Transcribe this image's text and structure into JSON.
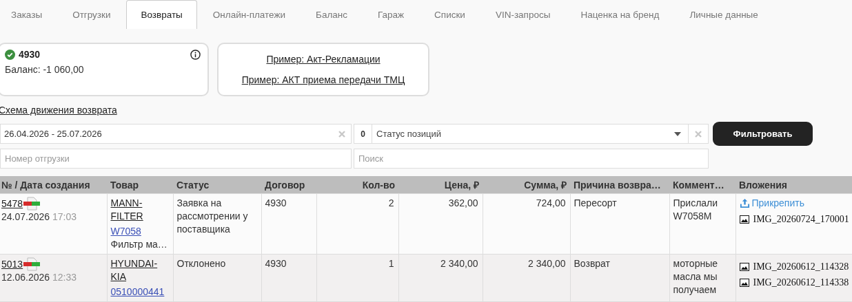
{
  "tabs": [
    {
      "label": "Заказы",
      "selected": false
    },
    {
      "label": "Отгрузки",
      "selected": false
    },
    {
      "label": "Возвраты",
      "selected": true
    },
    {
      "label": "Онлайн-платежи",
      "selected": false
    },
    {
      "label": "Баланс",
      "selected": false
    },
    {
      "label": "Гараж",
      "selected": false
    },
    {
      "label": "Списки",
      "selected": false
    },
    {
      "label": "VIN-запросы",
      "selected": false
    },
    {
      "label": "Наценка на бренд",
      "selected": false
    },
    {
      "label": "Личные данные",
      "selected": false
    }
  ],
  "account": {
    "number": "4930",
    "verified": true,
    "balance": "Баланс: -1 060,00"
  },
  "examples": [
    "Пример: Акт-Рекламации",
    "Пример: АКТ приема передачи ТМЦ"
  ],
  "scheme_link": "Схема движения возврата",
  "filters": {
    "date_range": "26.04.2026 - 25.07.2026",
    "status_count": "0",
    "status_placeholder": "Статус позиций",
    "filter_button": "Фильтровать",
    "shipment_placeholder": "Номер отгрузки",
    "search_placeholder": "Поиск"
  },
  "table": {
    "columns": [
      "№ / Дата создания",
      "Товар",
      "Статус",
      "Договор",
      "Кол-во",
      "Цена, ₽",
      "Сумма, ₽",
      "Причина возвра…",
      "Коммент…",
      "Вложения"
    ],
    "rows": [
      {
        "number": "5478",
        "date": "24.07.2026",
        "time": "17:03",
        "brand": "MANN-FILTER",
        "article": "W7058",
        "description": "Фильтр ма…",
        "status": "Заявка на рассмотрении у поставщика",
        "contract": "4930",
        "qty": "2",
        "price": "362,00",
        "sum": "724,00",
        "reason": "Пересорт",
        "comment": "Прислали W7058M",
        "attach_button": "Прикрепить",
        "attachments": [
          "IMG_20260724_170001"
        ]
      },
      {
        "number": "5013",
        "date": "12.06.2026",
        "time": "12:33",
        "brand": "HYUNDAI-KIA",
        "article": "0510000441",
        "status": "Отклонено",
        "contract": "4930",
        "qty": "1",
        "price": "2 340,00",
        "sum": "2 340,00",
        "reason": "Возврат",
        "comment": "моторные масла мы получаем",
        "attachments": [
          "IMG_20260612_114328",
          "IMG_20260612_114338"
        ]
      }
    ]
  }
}
